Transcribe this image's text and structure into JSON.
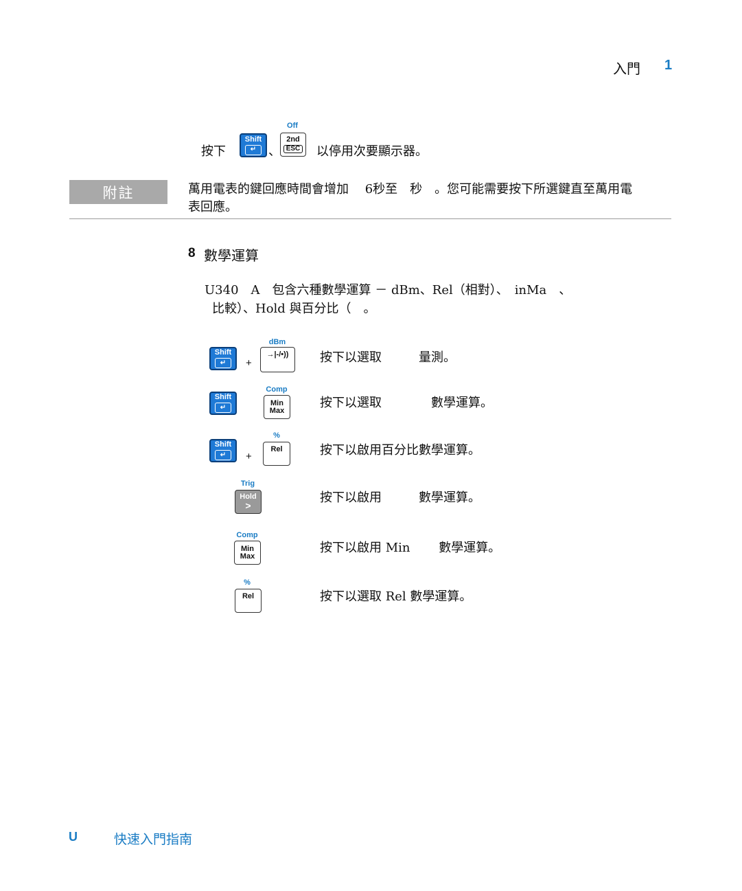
{
  "header": {
    "section_title": "入門",
    "chapter_number": "1"
  },
  "press_line": {
    "prefix": "按下",
    "separator": "、",
    "suffix": "以停用次要顯示器。"
  },
  "keys": {
    "shift": "Shift",
    "enter_glyph": "↵",
    "second_label": "2nd",
    "esc_label": "ESC",
    "off_label": "Off",
    "dbm_label": "dBm",
    "diode_glyph": "→|-/•))",
    "comp_label": "Comp",
    "min_label": "Min",
    "max_label": "Max",
    "percent_label": "%",
    "rel_label": "Rel",
    "trig_label": "Trig",
    "hold_label": "Hold",
    "hold_glyph": ">",
    "plus": "+"
  },
  "note": {
    "badge": "附註",
    "line1": "萬用電表的鍵回應時間會增加　 6秒至　秒　。您可能需要按下所選鍵直至萬用電",
    "line2": "表回應。"
  },
  "step": {
    "number": "8",
    "title": "數學運算"
  },
  "intro": {
    "line1": "U340　A　包含六種數學運算 － dBm、Rel（相對）、　inMa　、",
    "line2": "比較）、Hold 與百分比（　。"
  },
  "rows": [
    {
      "text": "按下以選取　　　量測。"
    },
    {
      "text": "按下以選取　　　　數學運算。"
    },
    {
      "text": "按下以啟用百分比數學運算。"
    },
    {
      "text": "按下以啟用　　　數學運算。"
    },
    {
      "text": "按下以啟用 Min　　 數學運算。"
    },
    {
      "text": "按下以選取 Rel 數學運算。"
    }
  ],
  "footer": {
    "letter": "U",
    "title": "快速入門指南"
  }
}
